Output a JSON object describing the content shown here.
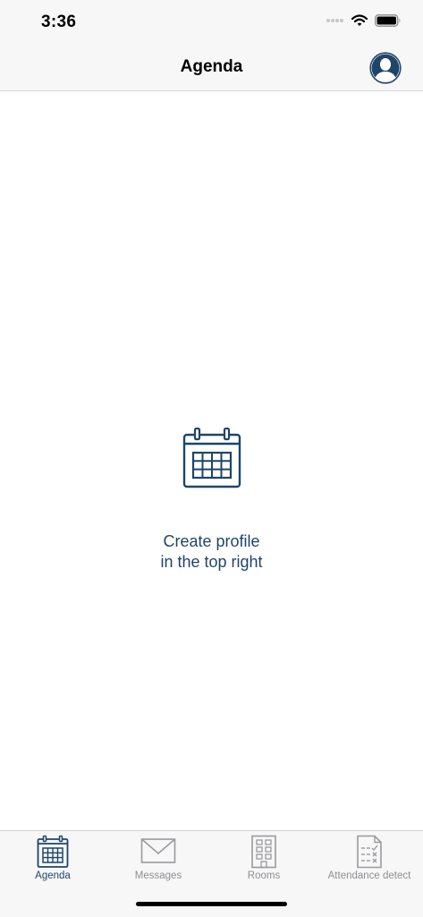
{
  "status_bar": {
    "time": "3:36"
  },
  "nav": {
    "title": "Agenda",
    "profile_icon": "person-circle-icon"
  },
  "empty_state": {
    "icon": "calendar-icon",
    "line1": "Create profile",
    "line2": "in the top right"
  },
  "tabs": [
    {
      "label": "Agenda",
      "icon": "calendar-icon",
      "active": true
    },
    {
      "label": "Messages",
      "icon": "envelope-icon",
      "active": false
    },
    {
      "label": "Rooms",
      "icon": "building-icon",
      "active": false
    },
    {
      "label": "Attendance detect",
      "icon": "checklist-icon",
      "active": false
    }
  ],
  "colors": {
    "accent": "#1f4569",
    "inactive": "#8e8e93",
    "bar_background": "#f7f7f7"
  }
}
